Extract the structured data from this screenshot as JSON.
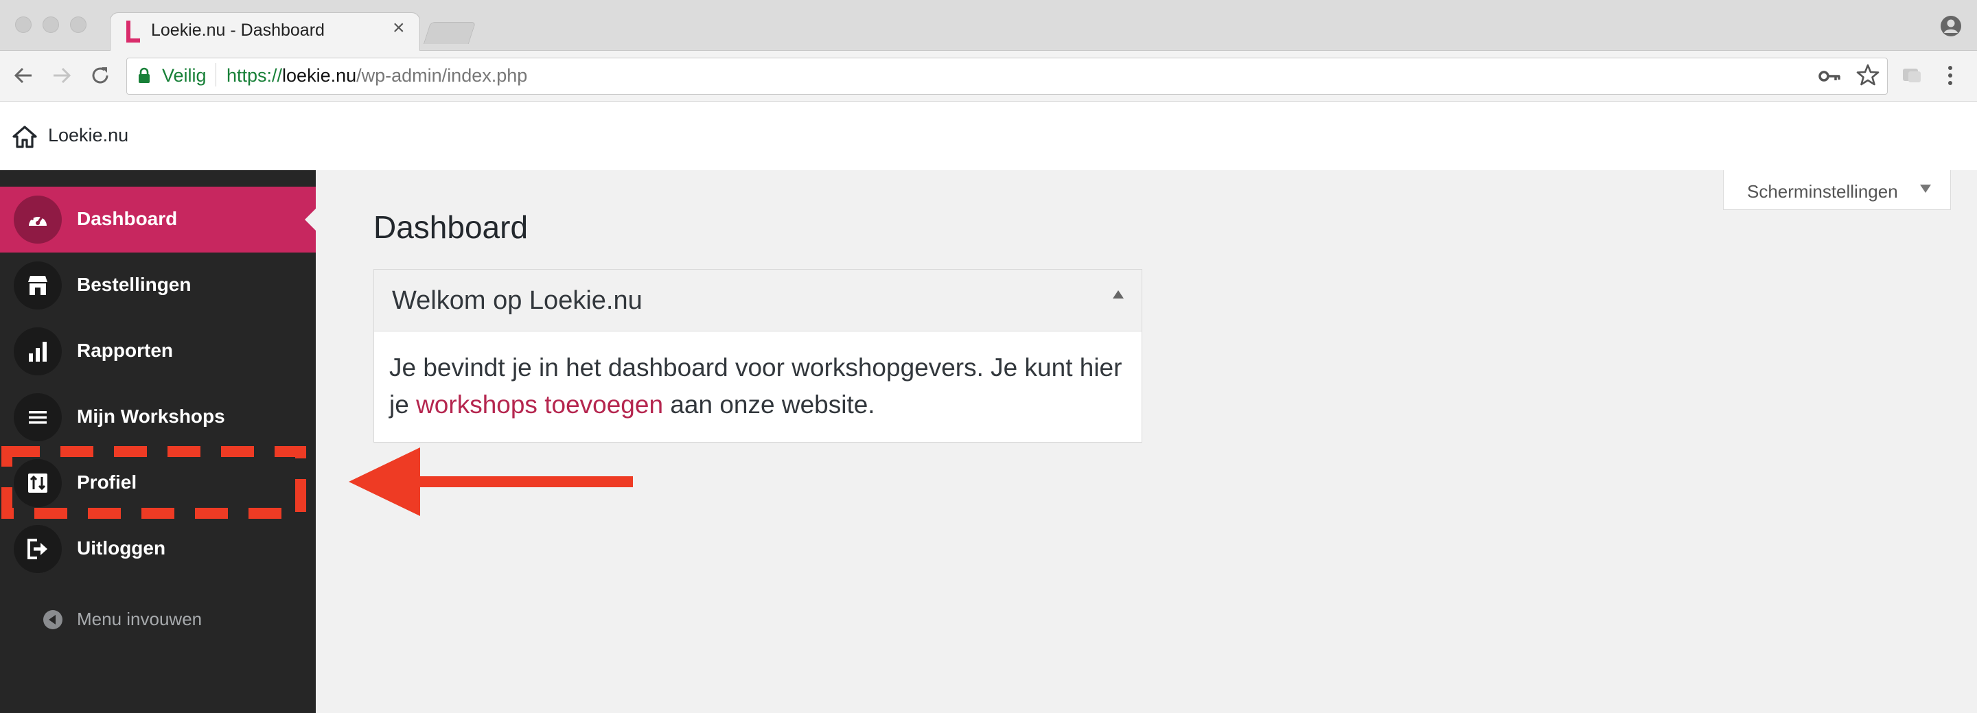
{
  "browser": {
    "tab_title": "Loekie.nu - Dashboard",
    "tab_close": "×",
    "secure_label": "Veilig",
    "url_protocol": "https://",
    "url_host": "loekie.nu",
    "url_path": "/wp-admin/index.php"
  },
  "adminbar": {
    "site_name": "Loekie.nu"
  },
  "sidebar": {
    "items": [
      {
        "label": "Dashboard",
        "icon": "dashboard-gauge-icon",
        "active": true
      },
      {
        "label": "Bestellingen",
        "icon": "store-icon",
        "active": false
      },
      {
        "label": "Rapporten",
        "icon": "bar-chart-icon",
        "active": false
      },
      {
        "label": "Mijn Workshops",
        "icon": "list-menu-icon",
        "active": false
      },
      {
        "label": "Profiel",
        "icon": "profile-sliders-icon",
        "active": false
      },
      {
        "label": "Uitloggen",
        "icon": "logout-icon",
        "active": false
      }
    ],
    "collapse_label": "Menu invouwen"
  },
  "content": {
    "screen_options": "Scherminstellingen",
    "page_title": "Dashboard",
    "panel": {
      "title": "Welkom op Loekie.nu",
      "text_before": "Je bevindt je in het dashboard voor workshopgevers. Je kunt hier je ",
      "link_text": "workshops toevoegen",
      "text_after": " aan onze website."
    }
  },
  "colors": {
    "accent": "#c7275f",
    "link": "#b5264f",
    "sidebar_bg": "#262626",
    "annotation": "#ee3b24",
    "secure_green": "#188038"
  }
}
